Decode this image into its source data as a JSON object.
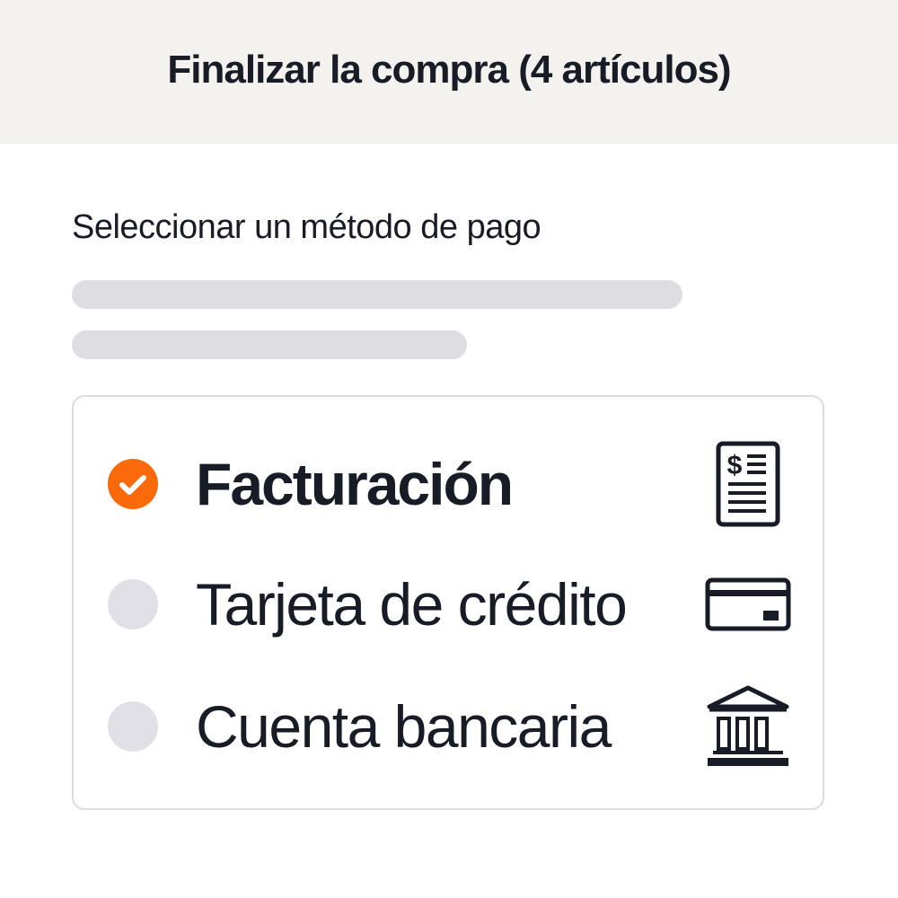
{
  "header": {
    "title": "Finalizar la compra (4 artículos)"
  },
  "payment": {
    "section_label": "Seleccionar un método de pago",
    "options": [
      {
        "label": "Facturación",
        "selected": true,
        "icon": "invoice-icon"
      },
      {
        "label": "Tarjeta de crédito",
        "selected": false,
        "icon": "credit-card-icon"
      },
      {
        "label": "Cuenta bancaria",
        "selected": false,
        "icon": "bank-icon"
      }
    ]
  },
  "colors": {
    "accent": "#fa6a0a",
    "header_bg": "#f3f2ee",
    "text": "#171c26",
    "placeholder": "#dddde2",
    "radio_unselected": "#e0e0e6",
    "card_border": "#dcdce0"
  }
}
